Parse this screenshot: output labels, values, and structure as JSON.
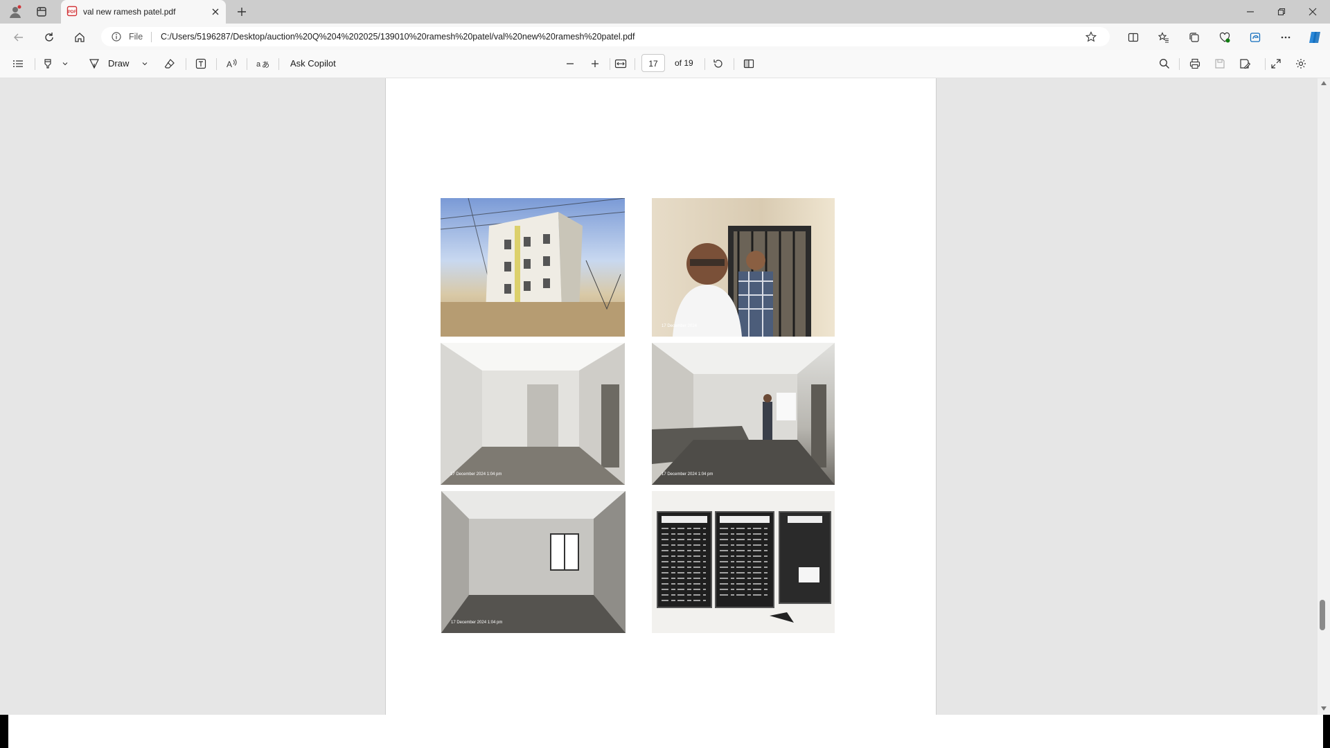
{
  "browser": {
    "tab": {
      "title": "val new ramesh patel.pdf"
    },
    "address": {
      "file_label": "File",
      "url": "C:/Users/5196287/Desktop/auction%20Q%204%202025/139010%20ramesh%20patel/val%20new%20ramesh%20patel.pdf"
    }
  },
  "pdf_toolbar": {
    "draw_label": "Draw",
    "ask_copilot_label": "Ask Copilot",
    "current_page": "17",
    "page_total_label": "of 19"
  },
  "document": {
    "photos": [
      {
        "subject": "building-exterior",
        "stamp": ""
      },
      {
        "subject": "two-persons-at-door",
        "stamp": "17 December 2024"
      },
      {
        "subject": "room-with-door",
        "stamp": "17 December 2024 1:04 pm"
      },
      {
        "subject": "kitchen-with-person",
        "stamp": "17 December 2024 1:04 pm"
      },
      {
        "subject": "empty-room-window",
        "stamp": "17 December 2024 1:04 pm"
      },
      {
        "subject": "notice-boards",
        "stamp": ""
      }
    ]
  },
  "colors": {
    "tabbar": "#cdcdcd",
    "toolbar": "#f9f9f9",
    "viewer_bg": "#e6e6e6",
    "accent": "#0f6cbd"
  }
}
